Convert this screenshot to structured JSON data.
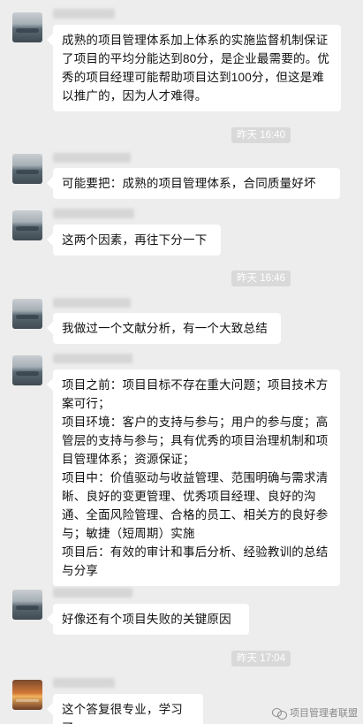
{
  "messages": [
    {
      "type": "incoming",
      "avatar": "lake-avatar",
      "text": "成熟的项目管理体系加上体系的实施监督机制保证了项目的平均分能达到80分，是企业最需要的。优秀的项目经理可能帮助项目达到100分，但这是难以推广的，因为人才难得。"
    },
    {
      "type": "timestamp",
      "text": "昨天 16:40"
    },
    {
      "type": "incoming",
      "avatar": "lake-avatar",
      "text": "可能要把：成熟的项目管理体系，合同质量好坏"
    },
    {
      "type": "incoming",
      "avatar": "lake-avatar",
      "text": "这两个因素，再往下分一下"
    },
    {
      "type": "timestamp",
      "text": "昨天 16:46"
    },
    {
      "type": "incoming",
      "avatar": "lake-avatar",
      "text": "我做过一个文献分析，有一个大致总结"
    },
    {
      "type": "incoming",
      "avatar": "lake-avatar",
      "text": "项目之前：项目目标不存在重大问题；项目技术方案可行；\n项目环境：客户的支持与参与；用户的参与度；高管层的支持与参与；具有优秀的项目治理机制和项目管理体系；资源保证；\n项目中：价值驱动与收益管理、范围明确与需求清晰、良好的变更管理、优秀项目经理、良好的沟通、全面风险管理、合格的员工、相关方的良好参与；敏捷（短周期）实施\n项目后：有效的审计和事后分析、经验教训的总结与分享"
    },
    {
      "type": "incoming",
      "avatar": "lake-avatar",
      "text": "好像还有个项目失败的关键原因"
    },
    {
      "type": "timestamp",
      "text": "昨天 17:04"
    },
    {
      "type": "incoming",
      "avatar": "sunset-avatar",
      "text": "这个答复很专业，学习了"
    }
  ],
  "watermark": {
    "text": "项目管理者联盟",
    "icon": "wechat-icon"
  }
}
